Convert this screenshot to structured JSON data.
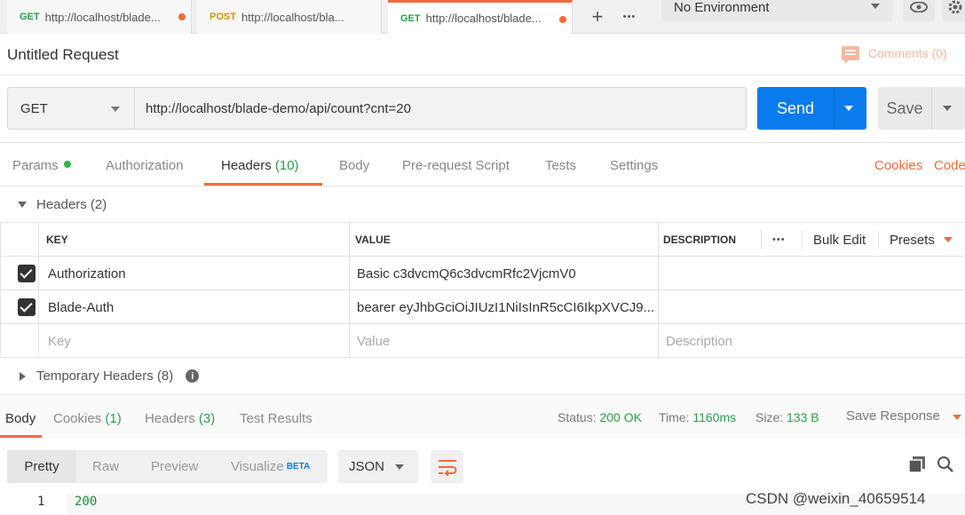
{
  "tabs": [
    {
      "method": "GET",
      "url": "http://localhost/blade...",
      "unsaved": true
    },
    {
      "method": "POST",
      "url": "http://localhost/bla...",
      "unsaved": false
    },
    {
      "method": "GET",
      "url": "http://localhost/blade...",
      "unsaved": true,
      "active": true
    }
  ],
  "toolbar": {
    "new_tab": "+",
    "more": "•••",
    "environment": "No Environment"
  },
  "request": {
    "title": "Untitled Request",
    "comments": "Comments (0)",
    "method": "GET",
    "url": "http://localhost/blade-demo/api/count?cnt=20",
    "send_label": "Send",
    "save_label": "Save"
  },
  "request_tabs": [
    {
      "label": "Params",
      "count": ""
    },
    {
      "label": "Authorization",
      "count": ""
    },
    {
      "label": "Headers",
      "count": "(10)"
    },
    {
      "label": "Body",
      "count": ""
    },
    {
      "label": "Pre-request Script",
      "count": ""
    },
    {
      "label": "Tests",
      "count": ""
    },
    {
      "label": "Settings",
      "count": ""
    }
  ],
  "request_links": {
    "cookies": "Cookies",
    "code": "Code"
  },
  "headers": {
    "section_title": "Headers (2)",
    "columns": {
      "key": "KEY",
      "value": "VALUE",
      "description": "DESCRIPTION"
    },
    "actions": {
      "more": "•••",
      "bulk_edit": "Bulk Edit",
      "presets": "Presets"
    },
    "rows": [
      {
        "checked": true,
        "key": "Authorization",
        "value": "Basic c3dvcmQ6c3dvcmRfc2VjcmV0",
        "description": ""
      },
      {
        "checked": true,
        "key": "Blade-Auth",
        "value": "bearer eyJhbGciOiJIUzI1NiIsInR5cCI6IkpXVCJ9....",
        "description": ""
      }
    ],
    "placeholders": {
      "key": "Key",
      "value": "Value",
      "description": "Description"
    },
    "temporary": "Temporary Headers (8)"
  },
  "response": {
    "tabs": [
      {
        "label": "Body",
        "count": ""
      },
      {
        "label": "Cookies",
        "count": "(1)"
      },
      {
        "label": "Headers",
        "count": "(3)"
      },
      {
        "label": "Test Results",
        "count": ""
      }
    ],
    "status_label": "Status:",
    "status": "200 OK",
    "time_label": "Time:",
    "time": "1160ms",
    "size_label": "Size:",
    "size": "133 B",
    "save_response": "Save Response",
    "views": [
      "Pretty",
      "Raw",
      "Preview",
      "Visualize"
    ],
    "beta": "BETA",
    "format": "JSON",
    "lines": [
      {
        "n": "1",
        "text": "200"
      }
    ]
  },
  "watermark": "CSDN @weixin_40659514",
  "colors": {
    "accent": "#f26b3a",
    "send": "#097bed",
    "success": "#2a9d4a"
  }
}
